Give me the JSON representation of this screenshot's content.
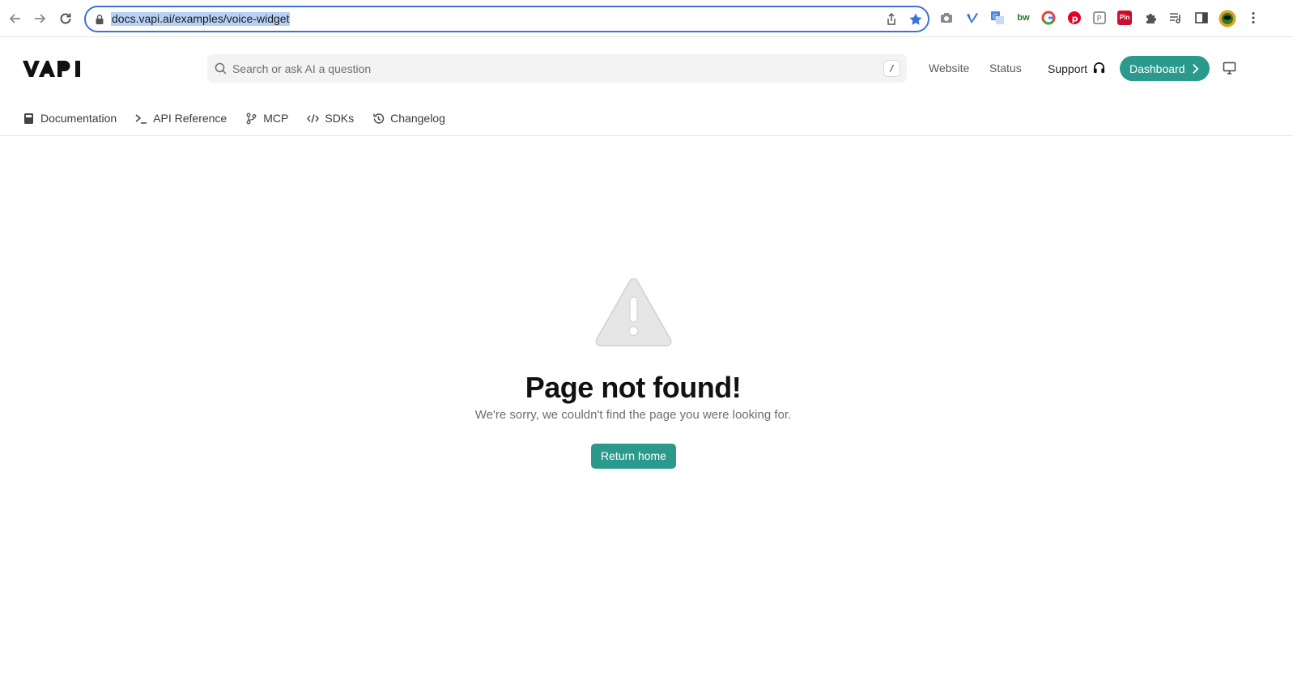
{
  "browser": {
    "url": "docs.vapi.ai/examples/voice-widget",
    "extensions": [
      "camera-icon",
      "vimeo-icon",
      "translate-icon",
      "bw-icon",
      "google-icon",
      "pinterest-icon",
      "p-icon",
      "pin-icon",
      "puzzle-icon",
      "reading-list-icon",
      "sidepanel-icon",
      "profile-avatar",
      "menu-dots-icon"
    ],
    "ext_labels": {
      "bw": "bw",
      "pin": "Pin"
    }
  },
  "header": {
    "logo_alt": "VAPI",
    "search_placeholder": "Search or ask AI a question",
    "search_shortcut": "/",
    "links": {
      "website": "Website",
      "status": "Status",
      "support": "Support"
    },
    "dashboard_label": "Dashboard"
  },
  "tabs": [
    {
      "label": "Documentation",
      "icon": "book-icon"
    },
    {
      "label": "API Reference",
      "icon": "terminal-icon"
    },
    {
      "label": "MCP",
      "icon": "git-branch-icon"
    },
    {
      "label": "SDKs",
      "icon": "code-icon"
    },
    {
      "label": "Changelog",
      "icon": "history-icon"
    }
  ],
  "main": {
    "title": "Page not found!",
    "subtitle": "We're sorry, we couldn't find the page you were looking for.",
    "return_label": "Return home"
  },
  "colors": {
    "accent": "#2b9a8c",
    "omnibox_focus": "#3b73d6",
    "url_highlight": "#b7d0f5"
  }
}
